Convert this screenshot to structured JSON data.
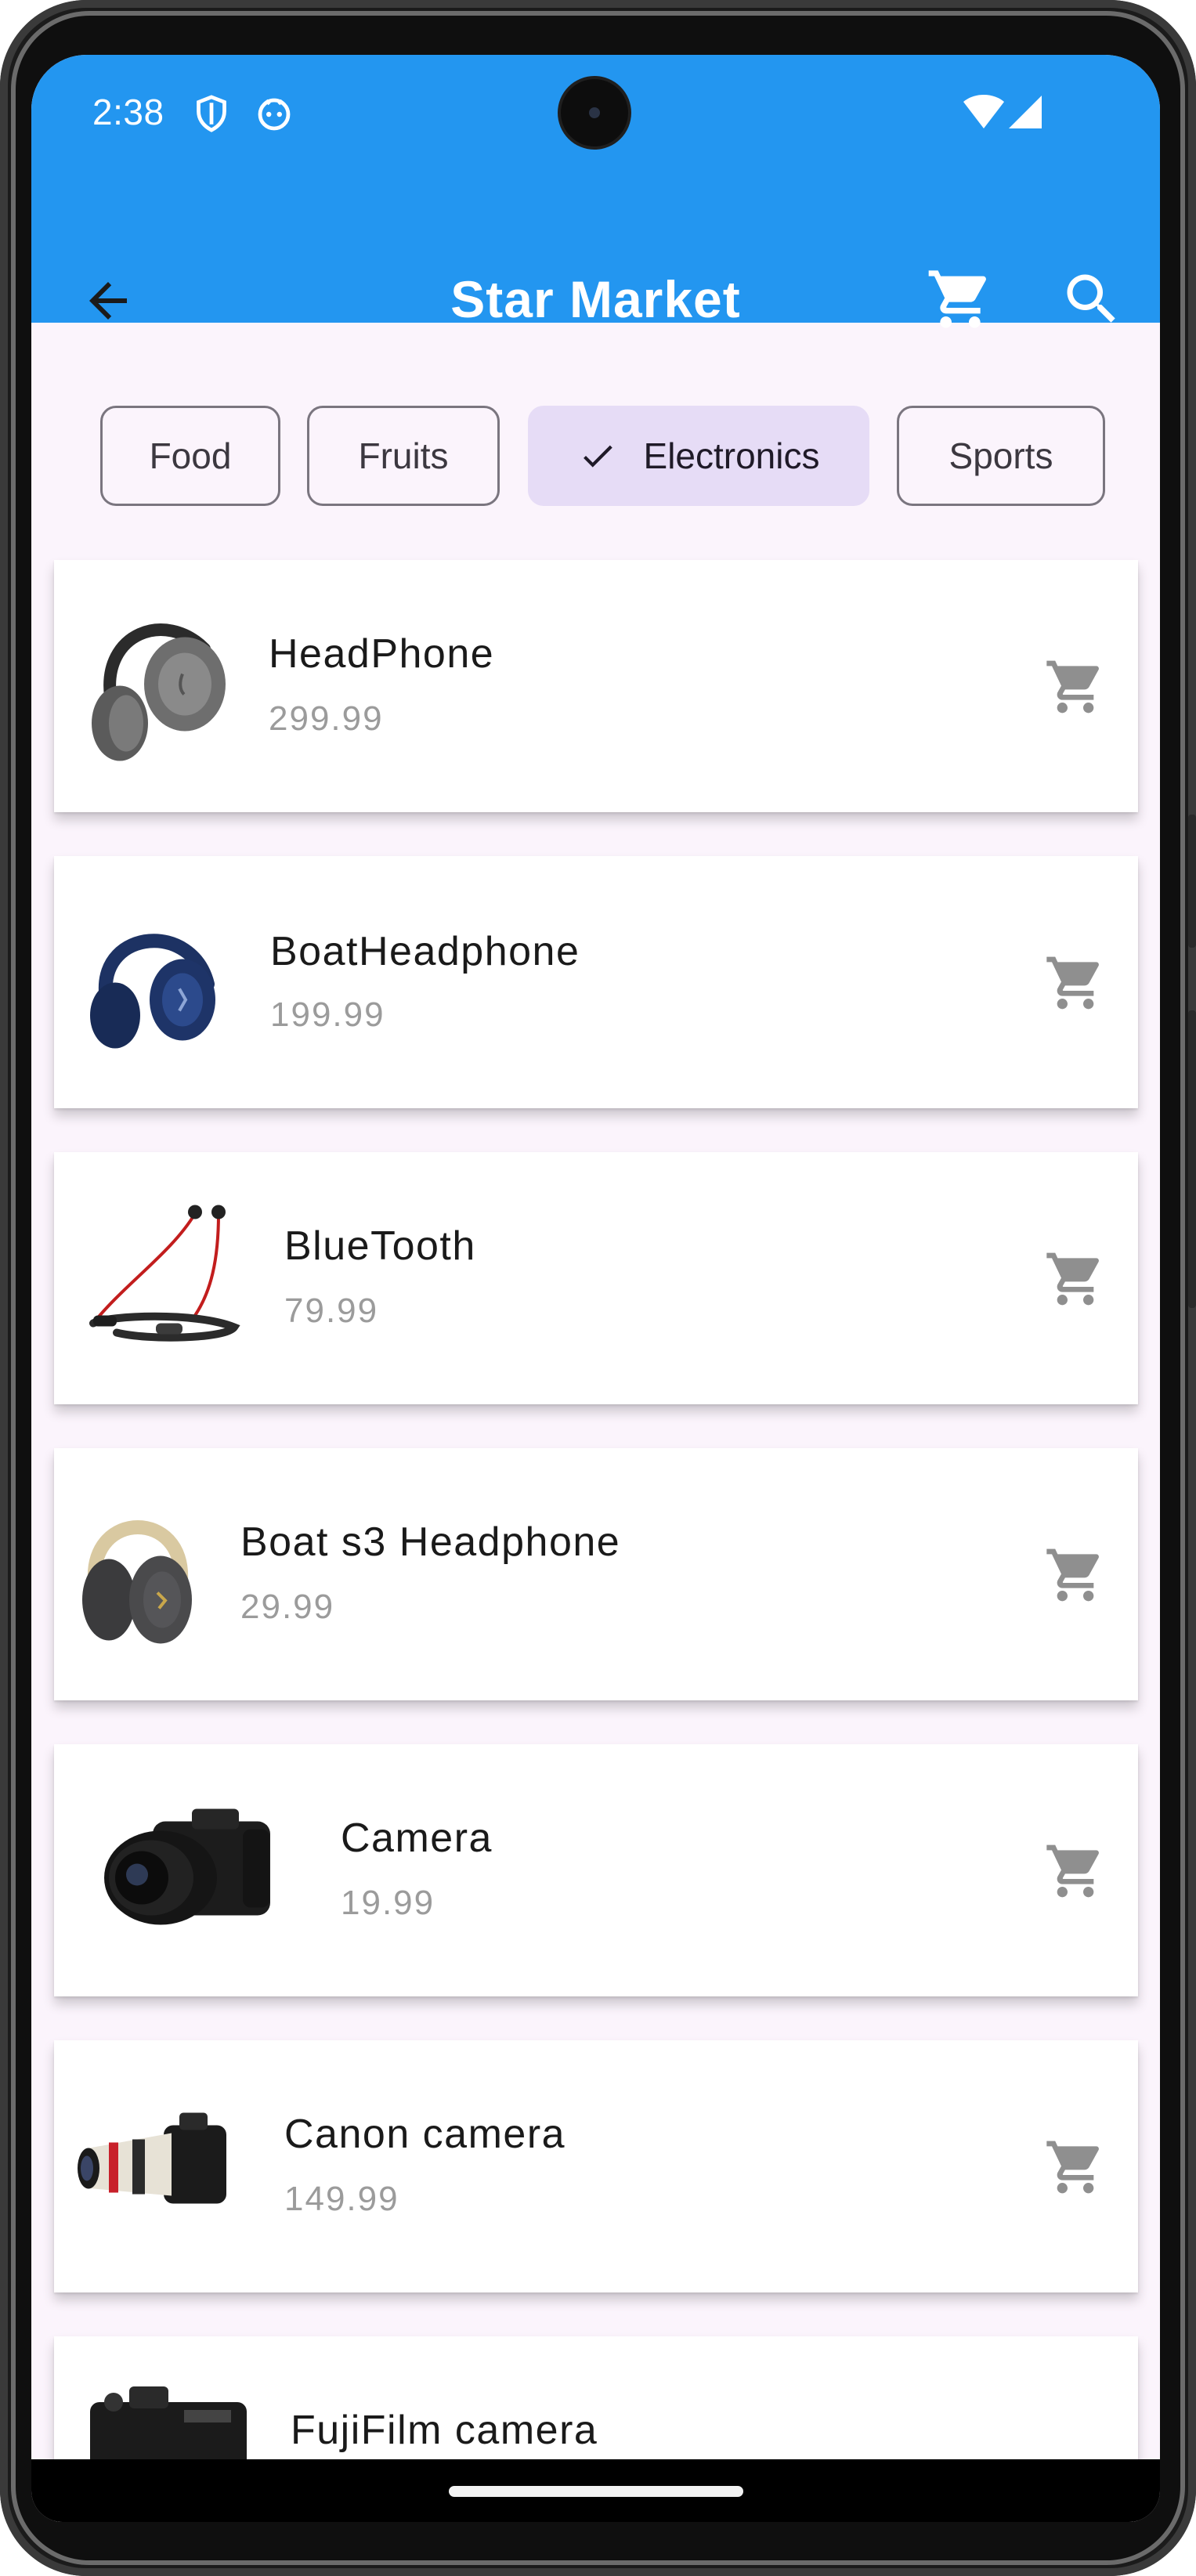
{
  "status_bar": {
    "time": "2:38",
    "icons": [
      "shield-icon",
      "android-robot-icon",
      "wifi-icon",
      "signal-icon"
    ]
  },
  "app_bar": {
    "title": "Star Market",
    "back_icon": "arrow-left-icon",
    "actions": [
      "shopping-cart-icon",
      "search-icon"
    ],
    "background": "#2396f0"
  },
  "categories": {
    "chips": [
      {
        "label": "Food",
        "selected": false
      },
      {
        "label": "Fruits",
        "selected": false
      },
      {
        "label": "Electronics",
        "selected": true
      },
      {
        "label": "Sports",
        "selected": false
      }
    ],
    "selected_color": "#e6dcf6"
  },
  "products": [
    {
      "name": "HeadPhone",
      "price": "299.99",
      "image": "gray-headphones"
    },
    {
      "name": "BoatHeadphone",
      "price": "199.99",
      "image": "navy-headphones"
    },
    {
      "name": "BlueTooth",
      "price": "79.99",
      "image": "neckband-earphones"
    },
    {
      "name": "Boat s3 Headphone",
      "price": "29.99",
      "image": "gray-gold-headphones"
    },
    {
      "name": "Camera",
      "price": "19.99",
      "image": "dslr-camera"
    },
    {
      "name": "Canon camera",
      "price": "149.99",
      "image": "telephoto-camera"
    },
    {
      "name": "FujiFilm camera",
      "price": "",
      "image": "fujifilm-camera"
    }
  ],
  "product_action_icon": "add-to-cart-icon"
}
